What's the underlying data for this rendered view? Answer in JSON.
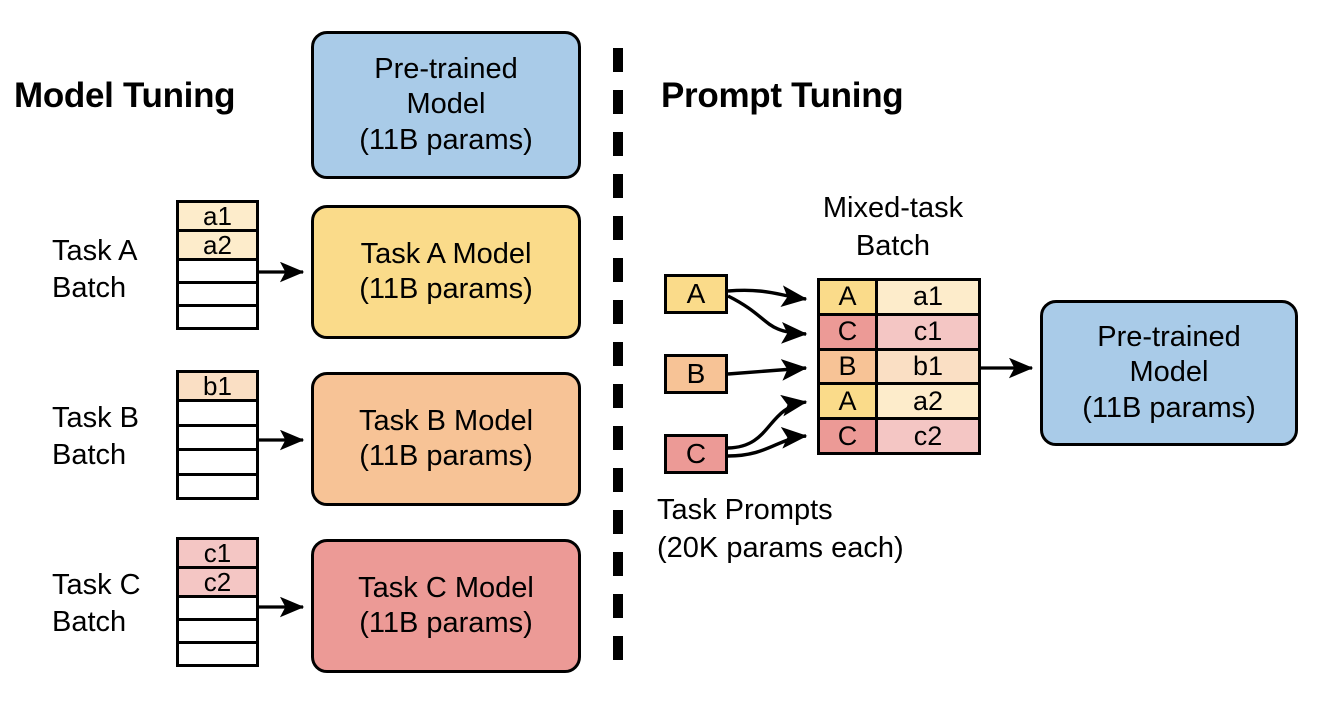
{
  "figure": {
    "type": "diagram",
    "description": "Comparison diagram of Model Tuning versus Prompt Tuning"
  },
  "colors": {
    "blue": "#a9cbe8",
    "yellow": "#fadb8a",
    "yellow_light": "#fdeccb",
    "orange": "#f7c396",
    "orange_light": "#fadfc4",
    "red": "#ec9a96",
    "red_light": "#f4c6c4",
    "white": "#ffffff",
    "stroke": "#000000"
  },
  "left": {
    "title": "Model Tuning",
    "pretrained_model": {
      "lines": [
        "Pre-trained",
        "Model",
        "(11B params)"
      ],
      "color": "blue"
    },
    "rows": [
      {
        "label_lines": [
          "Task A",
          "Batch"
        ],
        "batch_cells": [
          "a1",
          "a2",
          "",
          "",
          ""
        ],
        "batch_fill": "yellow_light",
        "model_lines": [
          "Task A Model",
          "(11B params)"
        ],
        "model_color": "yellow"
      },
      {
        "label_lines": [
          "Task B",
          "Batch"
        ],
        "batch_cells": [
          "b1",
          "",
          "",
          "",
          ""
        ],
        "batch_fill": "orange_light",
        "model_lines": [
          "Task B Model",
          "(11B params)"
        ],
        "model_color": "orange"
      },
      {
        "label_lines": [
          "Task C",
          "Batch"
        ],
        "batch_cells": [
          "c1",
          "c2",
          "",
          "",
          ""
        ],
        "batch_fill": "red_light",
        "model_lines": [
          "Task C Model",
          "(11B params)"
        ],
        "model_color": "red"
      }
    ]
  },
  "right": {
    "title": "Prompt Tuning",
    "mixed_batch_caption_lines": [
      "Mixed-task",
      "Batch"
    ],
    "prompts_caption_lines": [
      "Task Prompts",
      "(20K params each)"
    ],
    "prompt_chips": [
      {
        "label": "A",
        "color": "yellow"
      },
      {
        "label": "B",
        "color": "orange"
      },
      {
        "label": "C",
        "color": "red"
      }
    ],
    "mixed_batch_rows": [
      {
        "task": "A",
        "example": "a1",
        "task_color": "yellow",
        "example_color": "yellow_light"
      },
      {
        "task": "C",
        "example": "c1",
        "task_color": "red",
        "example_color": "red_light"
      },
      {
        "task": "B",
        "example": "b1",
        "task_color": "orange",
        "example_color": "orange_light"
      },
      {
        "task": "A",
        "example": "a2",
        "task_color": "yellow",
        "example_color": "yellow_light"
      },
      {
        "task": "C",
        "example": "c2",
        "task_color": "red",
        "example_color": "red_light"
      }
    ],
    "pretrained_model": {
      "lines": [
        "Pre-trained",
        "Model",
        "(11B params)"
      ],
      "color": "blue"
    }
  }
}
